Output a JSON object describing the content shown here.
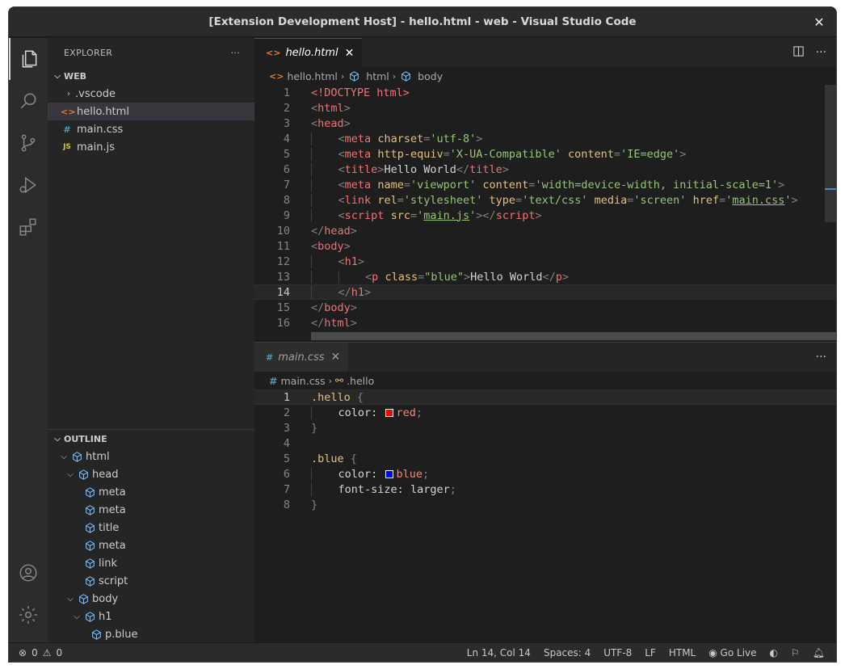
{
  "window": {
    "title": "[Extension Development Host] - hello.html - web - Visual Studio Code",
    "close_label": "✕"
  },
  "activity_bar": {
    "items": [
      "explorer-icon",
      "search-icon",
      "source-control-icon",
      "run-debug-icon",
      "extensions-icon"
    ],
    "bottom_items": [
      "account-icon",
      "manage-gear-icon"
    ]
  },
  "sidebar": {
    "title": "EXPLORER",
    "more_label": "···",
    "workspace": "WEB",
    "files": [
      {
        "name": ".vscode",
        "type": "folder"
      },
      {
        "name": "hello.html",
        "type": "html",
        "icon": "<>",
        "selected": true
      },
      {
        "name": "main.css",
        "type": "css",
        "icon": "#"
      },
      {
        "name": "main.js",
        "type": "js",
        "icon": "JS"
      }
    ],
    "outline": {
      "title": "OUTLINE",
      "items": [
        {
          "label": "html",
          "depth": 0,
          "expanded": true
        },
        {
          "label": "head",
          "depth": 1,
          "expanded": true
        },
        {
          "label": "meta",
          "depth": 2
        },
        {
          "label": "meta",
          "depth": 2
        },
        {
          "label": "title",
          "depth": 2
        },
        {
          "label": "meta",
          "depth": 2
        },
        {
          "label": "link",
          "depth": 2
        },
        {
          "label": "script",
          "depth": 2
        },
        {
          "label": "body",
          "depth": 1,
          "expanded": true
        },
        {
          "label": "h1",
          "depth": 2,
          "expanded": true
        },
        {
          "label": "p.blue",
          "depth": 3
        }
      ]
    }
  },
  "editor1": {
    "tab": {
      "label": "hello.html",
      "icon": "<>",
      "close": "✕"
    },
    "breadcrumb": [
      "hello.html",
      "html",
      "body"
    ],
    "current_line": 14,
    "lines": [
      "1",
      "2",
      "3",
      "4",
      "5",
      "6",
      "7",
      "8",
      "9",
      "10",
      "11",
      "12",
      "13",
      "14",
      "15",
      "16"
    ]
  },
  "editor2": {
    "tab": {
      "label": "main.css",
      "icon": "#",
      "close": "✕"
    },
    "breadcrumb": [
      "main.css",
      ".hello"
    ],
    "current_line": 1,
    "lines": [
      "1",
      "2",
      "3",
      "4",
      "5",
      "6",
      "7",
      "8"
    ],
    "more_label": "···"
  },
  "code_text": {
    "doctype": "<!DOCTYPE html>",
    "t_html": "html",
    "t_head": "head",
    "t_meta": "meta",
    "t_title": "title",
    "t_link": "link",
    "t_script": "script",
    "t_body": "body",
    "t_h1": "h1",
    "t_p": "p",
    "a_charset": "charset",
    "a_http": "http-equiv",
    "a_content": "content",
    "a_name": "name",
    "a_rel": "rel",
    "a_type": "type",
    "a_media": "media",
    "a_href": "href",
    "a_src": "src",
    "a_class": "class",
    "s_utf8": "'utf-8'",
    "s_xua": "'X-UA-Compatible'",
    "s_ie": "'IE=edge'",
    "s_viewport": "'viewport'",
    "s_vp_content": "'width=device-width, initial-scale=1'",
    "s_stylesheet": "'stylesheet'",
    "s_textcss": "'text/css'",
    "s_screen": "'screen'",
    "s_maincss": "main.css",
    "s_mainjs": "main.js",
    "s_blue": "\"blue\"",
    "title_text": "Hello World",
    "p_text": "Hello World",
    "css_hello": ".hello",
    "css_blue": ".blue",
    "css_color": "color:",
    "css_fontsize": "font-size:",
    "v_red": "red",
    "v_blue": "blue",
    "v_larger": "larger"
  },
  "colors": {
    "swatch_red": "#ff0000",
    "swatch_blue": "#0000ff",
    "accent": "#0e639c"
  },
  "statusbar": {
    "errors": "0",
    "warnings": "0",
    "position": "Ln 14, Col 14",
    "spaces": "Spaces: 4",
    "encoding": "UTF-8",
    "eol": "LF",
    "language": "HTML",
    "golive": "Go Live"
  }
}
